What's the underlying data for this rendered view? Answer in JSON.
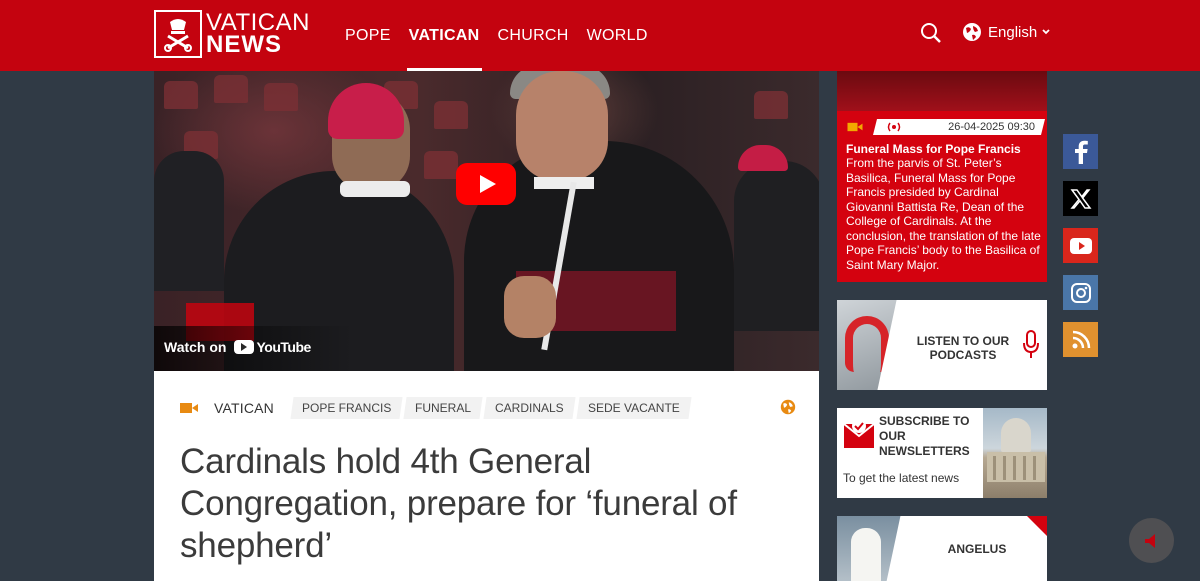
{
  "header": {
    "logo_top": "VATICAN",
    "logo_bottom": "NEWS",
    "nav": [
      {
        "label": "POPE"
      },
      {
        "label": "VATICAN",
        "active": true
      },
      {
        "label": "CHURCH"
      },
      {
        "label": "WORLD"
      }
    ],
    "language": "English",
    "brand_color": "#c4030f"
  },
  "video": {
    "watch_on": "Watch on",
    "provider": "YouTube"
  },
  "article": {
    "section": "VATICAN",
    "tags": [
      "POPE FRANCIS",
      "FUNERAL",
      "CARDINALS",
      "SEDE VACANTE"
    ],
    "headline": "Cardinals hold 4th General Congregation, prepare for ‘funeral of shepherd’"
  },
  "sidebar": {
    "live": {
      "datetime": "26-04-2025 09:30",
      "title": "Funeral Mass for Pope Francis",
      "description": "From the parvis of St. Peter’s Basilica, Funeral Mass for Pope Francis presided by Cardinal Giovanni Battista Re, Dean of the College of Cardinals. At the conclusion, the translation of the late Pope Francis’ body to the Basilica of Saint Mary Major."
    },
    "podcast": {
      "label": "LISTEN TO OUR PODCASTS"
    },
    "newsletter": {
      "title": "SUBSCRIBE TO OUR NEWSLETTERS",
      "subtitle": "To get the latest news"
    },
    "angelus": {
      "label": "ANGELUS"
    }
  },
  "social": [
    "facebook-icon",
    "x-icon",
    "youtube-icon",
    "instagram-icon",
    "rss-icon"
  ]
}
